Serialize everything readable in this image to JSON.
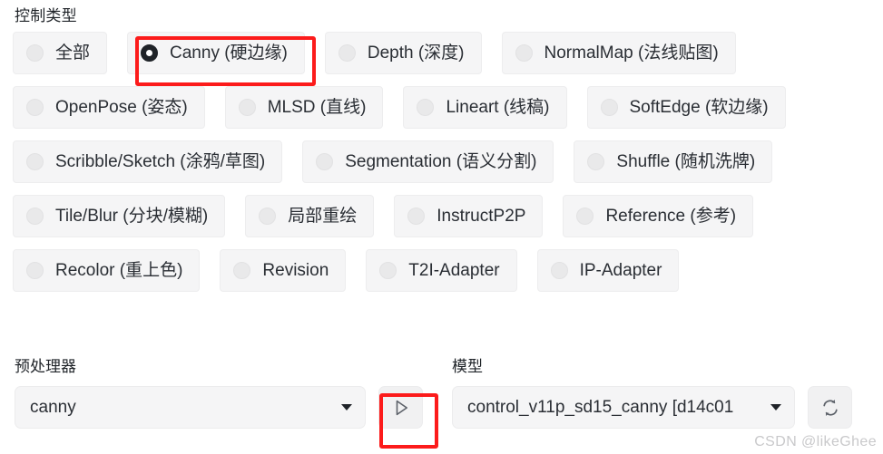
{
  "control_type": {
    "label": "控制类型",
    "selected": "Canny (硬边缘)",
    "rows": [
      [
        {
          "label": "全部",
          "checked": false
        },
        {
          "label": "Canny (硬边缘)",
          "checked": true
        },
        {
          "label": "Depth (深度)",
          "checked": false
        },
        {
          "label": "NormalMap (法线贴图)",
          "checked": false
        }
      ],
      [
        {
          "label": "OpenPose (姿态)",
          "checked": false
        },
        {
          "label": "MLSD (直线)",
          "checked": false
        },
        {
          "label": "Lineart (线稿)",
          "checked": false
        },
        {
          "label": "SoftEdge (软边缘)",
          "checked": false
        }
      ],
      [
        {
          "label": "Scribble/Sketch (涂鸦/草图)",
          "checked": false
        },
        {
          "label": "Segmentation (语义分割)",
          "checked": false
        },
        {
          "label": "Shuffle (随机洗牌)",
          "checked": false
        }
      ],
      [
        {
          "label": "Tile/Blur (分块/模糊)",
          "checked": false
        },
        {
          "label": "局部重绘",
          "checked": false
        },
        {
          "label": "InstructP2P",
          "checked": false
        },
        {
          "label": "Reference (参考)",
          "checked": false
        }
      ],
      [
        {
          "label": "Recolor (重上色)",
          "checked": false
        },
        {
          "label": "Revision",
          "checked": false
        },
        {
          "label": "T2I-Adapter",
          "checked": false
        },
        {
          "label": "IP-Adapter",
          "checked": false
        }
      ]
    ]
  },
  "preprocessor": {
    "label": "预处理器",
    "value": "canny",
    "run_button_icon": "play-triangle-icon"
  },
  "model": {
    "label": "模型",
    "value": "control_v11p_sd15_canny [d14c01",
    "refresh_button_icon": "refresh-icon"
  },
  "watermark": "CSDN @likeGhee",
  "colors": {
    "highlight": "#fc1b1b",
    "pill_bg": "#f5f5f6",
    "text": "#2a2e34"
  }
}
